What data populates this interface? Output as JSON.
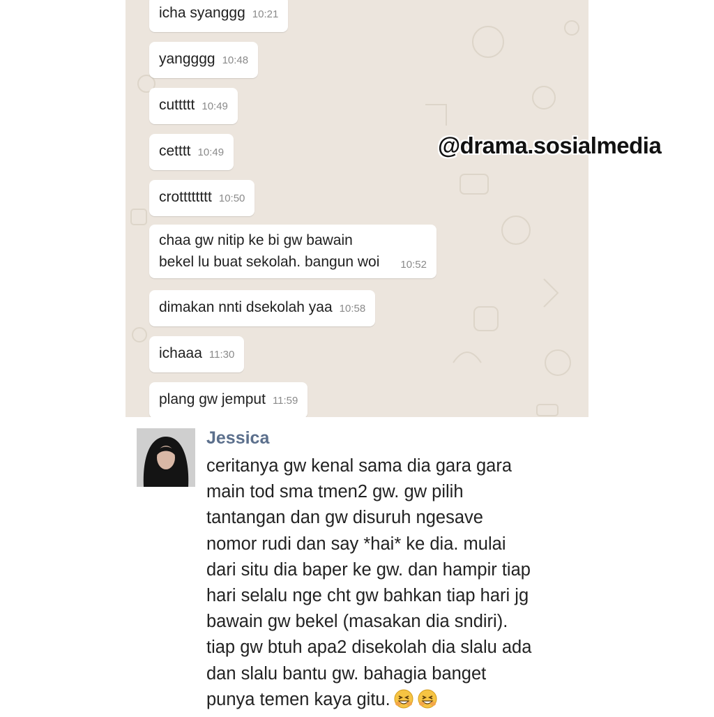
{
  "chat": {
    "messages": [
      {
        "text": "icha syanggg",
        "time": "10:21"
      },
      {
        "text": "yangggg",
        "time": "10:48"
      },
      {
        "text": "cuttttt",
        "time": "10:49"
      },
      {
        "text": "cetttt",
        "time": "10:49"
      },
      {
        "text": "crotttttttt",
        "time": "10:50"
      },
      {
        "text": "chaa gw nitip ke bi gw bawain\nbekel lu buat sekolah. bangun woi",
        "time": "10:52"
      },
      {
        "text": "dimakan nnti dsekolah yaa",
        "time": "10:58"
      },
      {
        "text": "ichaaa",
        "time": "11:30"
      },
      {
        "text": "plang gw jemput",
        "time": "11:59"
      }
    ]
  },
  "watermark": "@drama.sosialmedia",
  "comment": {
    "name": "Jessica",
    "text": "ceritanya gw kenal sama dia gara gara\nmain tod sma tmen2 gw. gw pilih\ntantangan dan gw disuruh ngesave\nnomor rudi dan say *hai* ke dia. mulai\ndari situ dia baper ke gw. dan hampir tiap\nhari selalu nge cht gw bahkan tiap hari jg\nbawain gw bekel (masakan dia sndiri).\ntiap gw btuh apa2 disekolah dia slalu ada\ndan slalu bantu gw. bahagia banget\npunya temen kaya gitu.",
    "emojis": [
      "grinning-squinting-face-icon",
      "grinning-squinting-face-icon"
    ]
  },
  "colors": {
    "chat_background": "#ece5dd",
    "bubble": "#ffffff",
    "top_bar": "#3f5f8a",
    "name": "#5b6f8c"
  }
}
